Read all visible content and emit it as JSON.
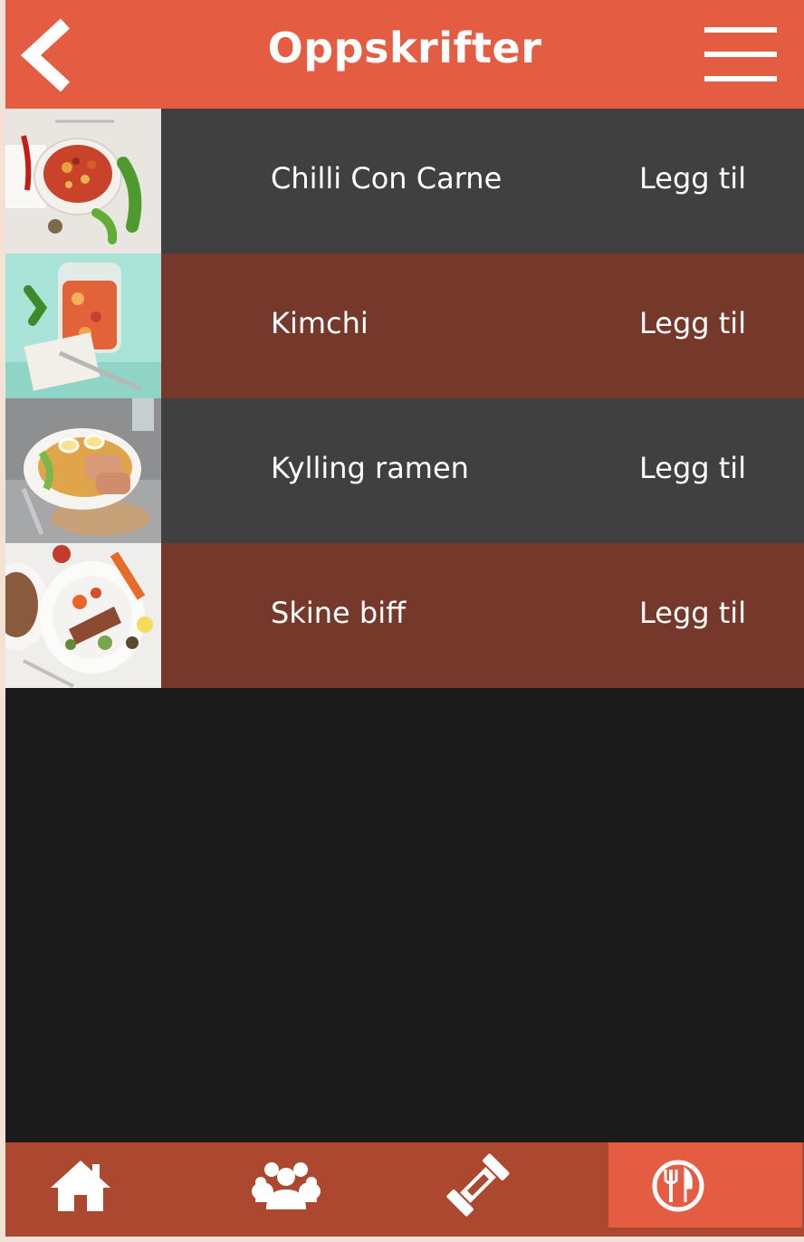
{
  "header": {
    "title": "Oppskrifter",
    "back_icon": "chevron-left-icon",
    "menu_icon": "hamburger-menu-icon"
  },
  "colors": {
    "accent": "#e45d43",
    "row_dark": "#404040",
    "row_brown": "#76382b",
    "nav_bg": "#ac4730",
    "content_bg": "#1b1b1b"
  },
  "recipes": [
    {
      "name": "Chilli Con Carne",
      "action": "Legg til",
      "row_color": "#404040"
    },
    {
      "name": "Kimchi",
      "action": "Legg til",
      "row_color": "#76382b"
    },
    {
      "name": "Kylling ramen",
      "action": "Legg til",
      "row_color": "#404040"
    },
    {
      "name": "Skine biff",
      "action": "Legg til",
      "row_color": "#76382b"
    }
  ],
  "bottom_nav": [
    {
      "icon": "home-icon",
      "active": false
    },
    {
      "icon": "group-icon",
      "active": false
    },
    {
      "icon": "dumbbell-icon",
      "active": false
    },
    {
      "icon": "fork-knife-plate-icon",
      "active": true
    }
  ]
}
